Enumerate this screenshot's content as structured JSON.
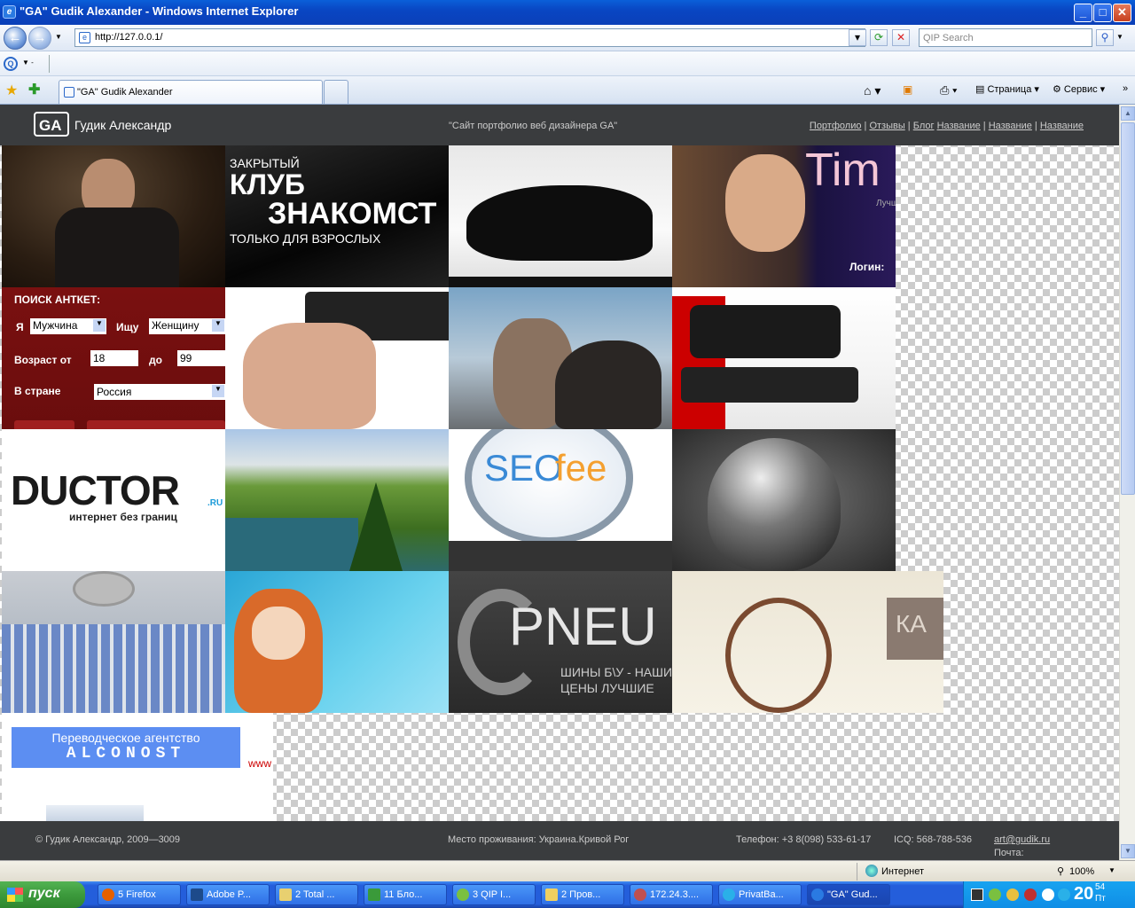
{
  "window": {
    "title": "\"GA\" Gudik Alexander - Windows Internet Explorer",
    "min": "_",
    "max": "□",
    "close": "✕"
  },
  "address": {
    "url": "http://127.0.0.1/",
    "search_placeholder": "QIP Search"
  },
  "tab": {
    "label": "\"GA\" Gudik Alexander"
  },
  "commands": {
    "page": "Страница",
    "service": "Сервис"
  },
  "site": {
    "logo": "Гудик Александр",
    "tagline": "\"Сайт портфолио веб дизайнера GA\"",
    "nav": [
      "Портфолио",
      "Отзывы",
      "Блог",
      "Название",
      "Название",
      "Название"
    ],
    "tiles": {
      "club": {
        "line1": "ЗАКРЫТЫЙ",
        "line2": "КЛУБ",
        "line3": "ЗНАКОМСТ",
        "line4": "ТОЛЬКО ДЛЯ ВЗРОСЛЫХ"
      },
      "tim": {
        "brand": "Tim",
        "sub": "Лучш",
        "login": "Логин:"
      },
      "search": {
        "title": "ПОИСК АНТКЕТ:",
        "i": "Я",
        "gender": "Мужчина",
        "seek": "Ищу",
        "seek_gender": "Женщину",
        "age_from_label": "Возраст от",
        "age_from": "18",
        "age_to_label": "до",
        "age_to": "99",
        "country_label": "В стране",
        "country": "Россия"
      },
      "ductor": {
        "brand": "DUCTOR",
        "suffix": ".RU",
        "slogan": "интернет без границ"
      },
      "seo": {
        "seo": "SEO",
        "fee": "fee"
      },
      "pneu": {
        "brand": "PNEU",
        "line1": "ШИНЫ Б\\У - НАШИ",
        "line2": "ЦЕНЫ ЛУЧШИЕ"
      },
      "ka": {
        "text": "КА"
      },
      "alconost": {
        "line1": "Переводческое агентство",
        "line2": "ALCONOST",
        "www": "www"
      }
    },
    "footer": {
      "copyright": "© Гудик Александр, 2009—3009",
      "location": "Место проживания: Украина.Кривой Рог",
      "phone": "Телефон: +3 8(098) 533-61-17",
      "icq": "ICQ: 568-788-536",
      "mail_label": "Почта:",
      "mail": "art@gudik.ru"
    }
  },
  "status": {
    "zone": "Интернет",
    "zoom": "100%"
  },
  "taskbar": {
    "start": "пуск",
    "tasks": [
      "5 Firefox",
      "Adobe P...",
      "2 Total ...",
      "11 Бло...",
      "3 QIP I...",
      "2 Пров...",
      "172.24.3....",
      "PrivatBa...",
      "\"GA\" Gud..."
    ],
    "clock": "20",
    "clock_min": "54",
    "day": "Пт"
  },
  "colors": {
    "header": "#3a3c3e",
    "search_panel": "#7a1010",
    "xp_blue": "#245edb"
  }
}
